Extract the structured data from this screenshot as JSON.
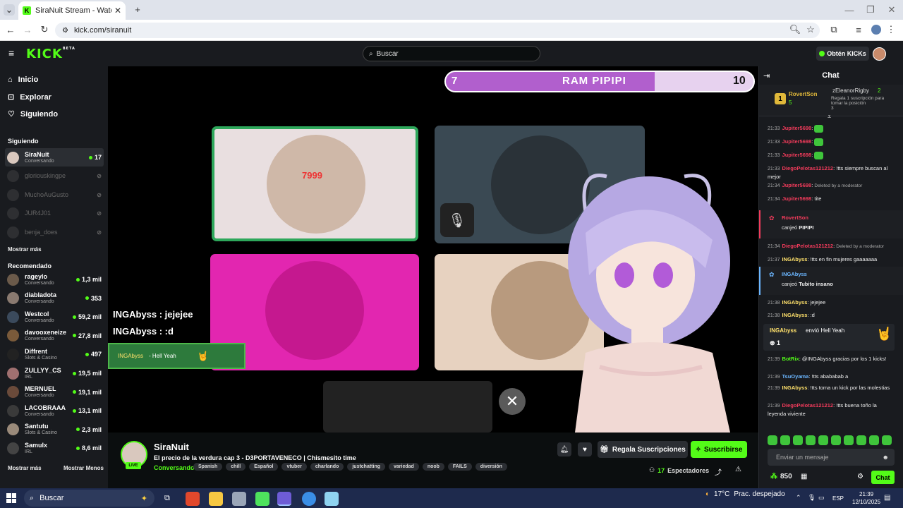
{
  "browser": {
    "tab_title": "SiraNuit Stream - Watch Live o",
    "url": "kick.com/siranuit"
  },
  "header": {
    "logo": "KICK",
    "logo_sup": "BETA",
    "search_placeholder": "Buscar",
    "kicks_button": "Obtén KICKs"
  },
  "sidebar": {
    "nav": [
      {
        "label": "Inicio",
        "icon": "home-icon"
      },
      {
        "label": "Explorar",
        "icon": "compass-icon"
      },
      {
        "label": "Siguiendo",
        "icon": "heart-icon"
      }
    ],
    "following_title": "Siguiendo",
    "following": [
      {
        "name": "SiraNuit",
        "category": "Conversando",
        "viewers": "17",
        "live": true
      },
      {
        "name": "gloriouskingpe",
        "live": false
      },
      {
        "name": "MuchoAuGusto",
        "live": false
      },
      {
        "name": "JUR4J01",
        "live": false
      },
      {
        "name": "benja_does",
        "live": false
      }
    ],
    "show_more_1": "Mostrar más",
    "recommended_title": "Recomendado",
    "recommended": [
      {
        "name": "rageylo",
        "category": "Conversando",
        "viewers": "1,3 mil"
      },
      {
        "name": "diabladota",
        "category": "Conversando",
        "viewers": "353"
      },
      {
        "name": "Westcol",
        "category": "Conversando",
        "viewers": "59,2 mil"
      },
      {
        "name": "davooxeneize",
        "category": "Conversando",
        "viewers": "27,8 mil"
      },
      {
        "name": "Diffrent",
        "category": "Slots & Casino",
        "viewers": "497"
      },
      {
        "name": "ZULLYY_CS",
        "category": "IRL",
        "viewers": "19,5 mil"
      },
      {
        "name": "MERNUEL",
        "category": "Conversando",
        "viewers": "19,1 mil"
      },
      {
        "name": "LACOBRAAA",
        "category": "Conversando",
        "viewers": "13,1 mil"
      },
      {
        "name": "Santutu",
        "category": "Slots & Casino",
        "viewers": "2,3 mil"
      },
      {
        "name": "Samulx",
        "category": "IRL",
        "viewers": "8,6 mil"
      }
    ],
    "show_more_2": "Mostrar más",
    "show_less": "Mostrar Menos"
  },
  "video": {
    "score_left": "7",
    "score_title": "RAM PIPIPI",
    "score_right": "10",
    "score_fraction": 0.68,
    "tile_text": "7999",
    "overlay_line1": "INGAbyss : jejejee",
    "overlay_line2": "INGAbyss : :d",
    "alert_user": "INGAbyss",
    "alert_text": "- Hell Yeah"
  },
  "stream": {
    "channel": "SiraNuit",
    "live_badge": "LIVE",
    "title": "El precio de la verdura cap 3 - D3PORTAVENECO | Chismesito time",
    "category": "Conversando",
    "tags": [
      "Spanish",
      "chill",
      "Español",
      "vtuber",
      "charlando",
      "justchatting",
      "variedad",
      "noob",
      "FAILS",
      "diversión"
    ],
    "gift_button": "Regala Suscripciones",
    "subscribe_button": "Suscribirse",
    "viewers": "17",
    "viewers_label": "Espectadores"
  },
  "chat": {
    "title": "Chat",
    "pinned": {
      "rank": "1",
      "user1": "RovertSon",
      "user1_count": "5",
      "user2": "zEleanorRigby",
      "user2_count": "2",
      "promo": "Regala 1 suscripción para tomar la posición",
      "promo_num": "3"
    },
    "messages": [
      {
        "time": "21:33",
        "user": "Jupiter5698",
        "text": "",
        "color": "red",
        "emote": true
      },
      {
        "time": "21:33",
        "user": "Jupiter5698",
        "text": "",
        "color": "red",
        "emote": true
      },
      {
        "time": "21:33",
        "user": "Jupiter5698",
        "text": "",
        "color": "red",
        "emote": true
      },
      {
        "time": "21:33",
        "user": "DiegoPelotas121212",
        "text": "!tts siempre buscan al mejor",
        "color": "red"
      },
      {
        "time": "21:34",
        "user": "Jupiter5698",
        "text": "Deleted by a moderator",
        "color": "red",
        "deleted": true
      },
      {
        "time": "21:34",
        "user": "Jupiter5698",
        "text": "tite",
        "color": "red"
      }
    ],
    "redeem1": {
      "user": "RovertSon",
      "action": "canjeó",
      "item": "PIPIPI"
    },
    "messages2": [
      {
        "time": "21:34",
        "user": "DiegoPelotas121212",
        "text": "Deleted by a moderator",
        "color": "red",
        "deleted": true
      },
      {
        "time": "21:37",
        "user": "INGAbyss",
        "text": "!tts en fin mujeres gaaaaaaa",
        "color": "yel"
      }
    ],
    "redeem2": {
      "user": "INGAbyss",
      "action": "canjeó",
      "item": "Tubito insano"
    },
    "messages3": [
      {
        "time": "21:38",
        "user": "INGAbyss",
        "text": "jejejee",
        "color": "yel"
      },
      {
        "time": "21:38",
        "user": "INGAbyss",
        "text": ":d",
        "color": "yel"
      }
    ],
    "kick_event": {
      "user": "INGAbyss",
      "action": "envió",
      "item": "Hell Yeah",
      "count": "1"
    },
    "messages4": [
      {
        "time": "21:39",
        "user": "BotRix",
        "text": "@INGAbyss gracias por los 1 kicks!",
        "color": "grn"
      },
      {
        "time": "21:39",
        "user": "TsuOyama",
        "text": "!tts abababab a",
        "color": "blu"
      },
      {
        "time": "21:39",
        "user": "INGAbyss",
        "text": "!tts toma un kick por las molestias",
        "color": "yel"
      },
      {
        "time": "21:39",
        "user": "DiegoPelotas121212",
        "text": "!tts buena toño la leyenda viviente",
        "color": "red"
      }
    ],
    "input_placeholder": "Enviar un mensaje",
    "points": "850",
    "chat_button": "Chat"
  },
  "taskbar": {
    "search": "Buscar",
    "temp": "17°C",
    "weather": "Prac. despejado",
    "lang": "ESP",
    "time": "21:39",
    "date": "12/10/2025"
  }
}
